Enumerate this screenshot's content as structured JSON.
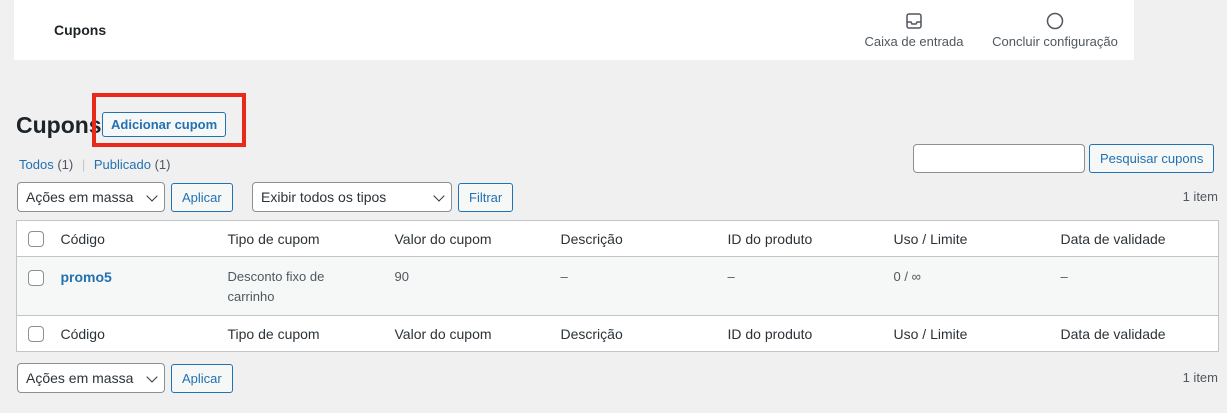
{
  "topbar": {
    "title": "Cupons",
    "inbox_label": "Caixa de entrada",
    "setup_label": "Concluir configuração"
  },
  "header": {
    "title": "Cupons",
    "add_button": "Adicionar cupom"
  },
  "filters": {
    "all_label": "Todos",
    "all_count": "(1)",
    "published_label": "Publicado",
    "published_count": "(1)"
  },
  "search": {
    "button": "Pesquisar cupons",
    "value": ""
  },
  "toolbar_top": {
    "bulk_actions": "Ações em massa",
    "apply": "Aplicar",
    "type_filter": "Exibir todos os tipos",
    "filter": "Filtrar",
    "count": "1 item"
  },
  "table": {
    "columns": [
      "Código",
      "Tipo de cupom",
      "Valor do cupom",
      "Descrição",
      "ID do produto",
      "Uso / Limite",
      "Data de validade"
    ],
    "rows": [
      {
        "code": "promo5",
        "type": "Desconto fixo de carrinho",
        "value": "90",
        "description": "–",
        "product_id": "–",
        "usage": "0 / ∞",
        "expiry": "–"
      }
    ]
  },
  "toolbar_bottom": {
    "bulk_actions": "Ações em massa",
    "apply": "Aplicar",
    "count": "1 item"
  },
  "colors": {
    "accent": "#2271b1",
    "highlight": "#e8291c",
    "background": "#f0f0f1"
  }
}
